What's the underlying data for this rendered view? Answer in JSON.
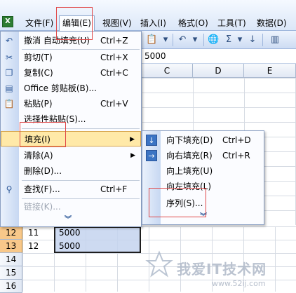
{
  "menubar": {
    "items": [
      {
        "label": "文件(F)",
        "active": false
      },
      {
        "label": "编辑(E)",
        "active": true
      },
      {
        "label": "视图(V)",
        "active": false
      },
      {
        "label": "插入(I)",
        "active": false
      },
      {
        "label": "格式(O)",
        "active": false
      },
      {
        "label": "工具(T)",
        "active": false
      },
      {
        "label": "数据(D)",
        "active": false
      }
    ]
  },
  "toolbar": {
    "icons": [
      "paste-icon",
      "paste-dropdown-icon",
      "undo-icon",
      "hyperlink-icon",
      "autosum-icon",
      "sort-ascending-icon",
      "chart-icon"
    ],
    "sigma": "Σ"
  },
  "formula_bar": {
    "value": "5000"
  },
  "columns": [
    "C",
    "D",
    "E"
  ],
  "rows": [
    {
      "num": "12",
      "a": "11",
      "b": "5000",
      "selected": true
    },
    {
      "num": "13",
      "a": "12",
      "b": "5000",
      "selected": true
    },
    {
      "num": "14",
      "a": "",
      "b": "",
      "selected": false
    },
    {
      "num": "15",
      "a": "",
      "b": "",
      "selected": false
    },
    {
      "num": "16",
      "a": "",
      "b": "",
      "selected": false
    }
  ],
  "edit_menu": {
    "items": [
      {
        "label": "撤消 自动填充(U)",
        "shortcut": "Ctrl+Z",
        "icon": "undo-icon"
      },
      {
        "label": "剪切(T)",
        "shortcut": "Ctrl+X",
        "icon": "cut-icon"
      },
      {
        "label": "复制(C)",
        "shortcut": "Ctrl+C",
        "icon": "copy-icon"
      },
      {
        "label": "Office 剪贴板(B)...",
        "shortcut": "",
        "icon": "clipboard-icon"
      },
      {
        "label": "粘贴(P)",
        "shortcut": "Ctrl+V",
        "icon": "paste-icon"
      },
      {
        "label": "选择性粘贴(S)...",
        "shortcut": "",
        "icon": ""
      },
      {
        "label": "填充(I)",
        "shortcut": "",
        "icon": "",
        "submenu": true
      },
      {
        "label": "清除(A)",
        "shortcut": "",
        "icon": "",
        "submenu": true
      },
      {
        "label": "删除(D)...",
        "shortcut": "",
        "icon": ""
      },
      {
        "label": "查找(F)...",
        "shortcut": "Ctrl+F",
        "icon": "binoculars-icon"
      },
      {
        "label": "链接(K)...",
        "shortcut": "",
        "icon": "",
        "disabled": true
      }
    ]
  },
  "fill_submenu": {
    "items": [
      {
        "label": "向下填充(D)",
        "shortcut": "Ctrl+D",
        "icon": "fill-down-icon"
      },
      {
        "label": "向右填充(R)",
        "shortcut": "Ctrl+R",
        "icon": "fill-right-icon"
      },
      {
        "label": "向上填充(U)",
        "shortcut": "",
        "icon": ""
      },
      {
        "label": "向左填充(L)",
        "shortcut": "",
        "icon": ""
      },
      {
        "label": "序列(S)...",
        "shortcut": "",
        "icon": ""
      }
    ]
  },
  "watermark": {
    "text": "我爱IT技术网",
    "url": "www.52ij.com"
  },
  "colors": {
    "highlight": "#ffe9a8",
    "annotation": "#e04848",
    "selected_row": "#f8c88a"
  }
}
